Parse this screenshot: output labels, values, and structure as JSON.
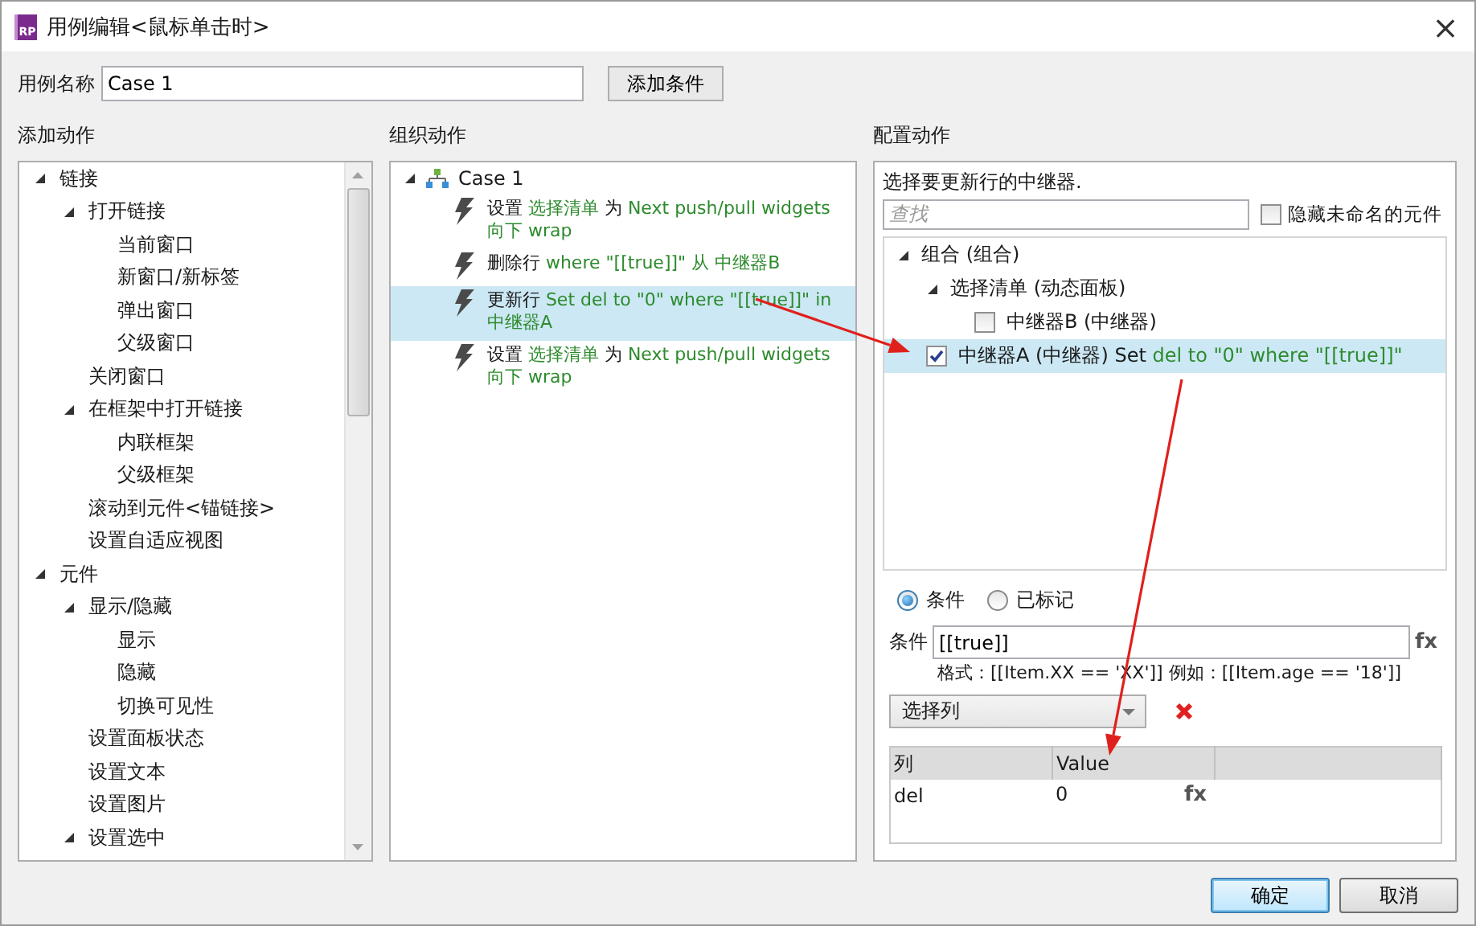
{
  "window": {
    "icon_label": "RP",
    "title": "用例编辑<鼠标单击时>",
    "close": "×"
  },
  "case_name": {
    "label": "用例名称",
    "value": "Case 1"
  },
  "add_condition_button": "添加条件",
  "add_actions": {
    "heading": "添加动作",
    "items": [
      {
        "label": "链接",
        "expanded": true,
        "children": [
          {
            "label": "打开链接",
            "expanded": true,
            "children": [
              {
                "label": "当前窗口"
              },
              {
                "label": "新窗口/新标签"
              },
              {
                "label": "弹出窗口"
              },
              {
                "label": "父级窗口"
              }
            ]
          },
          {
            "label": "关闭窗口"
          },
          {
            "label": "在框架中打开链接",
            "expanded": true,
            "children": [
              {
                "label": "内联框架"
              },
              {
                "label": "父级框架"
              }
            ]
          },
          {
            "label": "滚动到元件<锚链接>"
          },
          {
            "label": "设置自适应视图"
          }
        ]
      },
      {
        "label": "元件",
        "expanded": true,
        "children": [
          {
            "label": "显示/隐藏",
            "expanded": true,
            "children": [
              {
                "label": "显示"
              },
              {
                "label": "隐藏"
              },
              {
                "label": "切换可见性"
              }
            ]
          },
          {
            "label": "设置面板状态"
          },
          {
            "label": "设置文本"
          },
          {
            "label": "设置图片"
          },
          {
            "label": "设置选中",
            "expanded": true
          }
        ]
      }
    ]
  },
  "organize_actions": {
    "heading": "组织动作",
    "case": {
      "label": "Case 1",
      "expanded": true,
      "actions": [
        {
          "selected": false,
          "segments": [
            {
              "text": "设置 ",
              "kind": "plain"
            },
            {
              "text": "选择清单",
              "kind": "value"
            },
            {
              "text": " 为 ",
              "kind": "plain"
            },
            {
              "text": "Next push/pull widgets 向下 wrap",
              "kind": "value"
            }
          ]
        },
        {
          "selected": false,
          "segments": [
            {
              "text": "删除行 ",
              "kind": "plain"
            },
            {
              "text": "where \"[[true]]\" 从 中继器B",
              "kind": "value"
            }
          ]
        },
        {
          "selected": true,
          "segments": [
            {
              "text": "更新行 ",
              "kind": "plain"
            },
            {
              "text": "Set del to \"0\" where \"[[true]]\" in 中继器A",
              "kind": "value"
            }
          ]
        },
        {
          "selected": false,
          "segments": [
            {
              "text": "设置 ",
              "kind": "plain"
            },
            {
              "text": "选择清单",
              "kind": "value"
            },
            {
              "text": " 为 ",
              "kind": "plain"
            },
            {
              "text": "Next push/pull widgets 向下 wrap",
              "kind": "value"
            }
          ]
        }
      ]
    }
  },
  "configure_action": {
    "heading": "配置动作",
    "caption": "选择要更新行的中继器.",
    "search": {
      "placeholder": "查找"
    },
    "hide_unnamed": {
      "label": "隐藏未命名的元件",
      "checked": false
    },
    "tree": [
      {
        "kind": "group",
        "label": "组合 (组合)",
        "expanded": true,
        "children": [
          {
            "kind": "group",
            "label": "选择清单 (动态面板)",
            "expanded": true,
            "children": [
              {
                "kind": "check",
                "label": "中继器B (中继器)",
                "checked": false,
                "selected": false
              }
            ]
          },
          {
            "kind": "check",
            "label": "中继器A (中继器) Set ",
            "detail": "del to \"0\" where \"[[true]]\"",
            "checked": true,
            "selected": true
          }
        ]
      }
    ],
    "mode": [
      {
        "label": "条件",
        "selected": true
      },
      {
        "label": "已标记",
        "selected": false
      }
    ],
    "condition": {
      "label": "条件",
      "value": "[[true]]",
      "fx": "fx",
      "hint": "格式：[[Item.XX == 'XX']] 例如：[[Item.age == '18']]"
    },
    "column_select": {
      "value": "选择列"
    },
    "table": {
      "columns": [
        "列",
        "Value"
      ],
      "rows": [
        {
          "cells": [
            "del",
            "0"
          ],
          "fx": "fx"
        }
      ]
    }
  },
  "buttons": [
    {
      "label": "确定",
      "primary": true
    },
    {
      "label": "取消",
      "primary": false
    }
  ],
  "annotations": [
    {
      "kind": "arrow"
    },
    {
      "kind": "arrow"
    }
  ]
}
